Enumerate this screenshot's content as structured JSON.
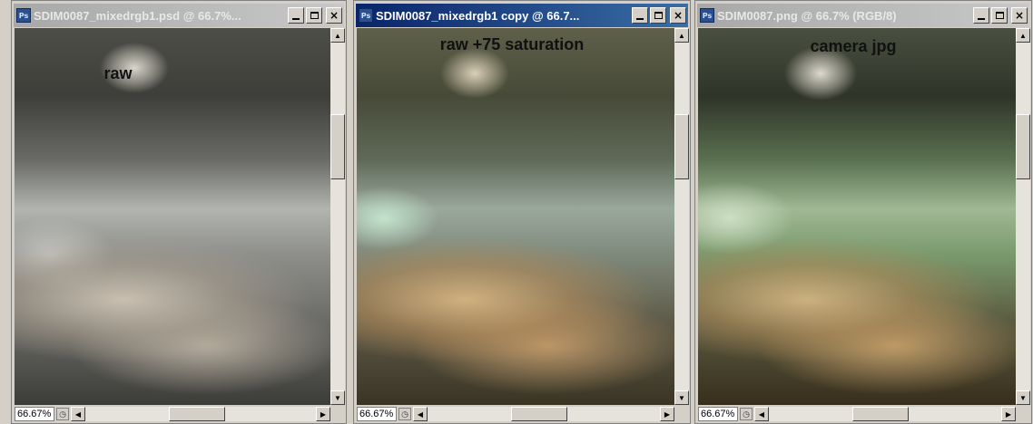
{
  "app_icon": "photoshop-document-icon",
  "icon_label": "Ps",
  "windows": [
    {
      "title": "SDIM0087_mixedrgb1.psd @ 66.7%...",
      "label": "raw",
      "zoom": "66.67%",
      "state": "inactive"
    },
    {
      "title": "SDIM0087_mixedrgb1 copy @ 66.7...",
      "label": "raw +75 saturation",
      "zoom": "66.67%",
      "state": "active"
    },
    {
      "title": "SDIM0087.png @ 66.7% (RGB/8)",
      "label": "camera jpg",
      "zoom": "66.67%",
      "state": "inactive"
    }
  ],
  "buttons": {
    "minimize": "minimize",
    "maximize": "maximize",
    "close": "×"
  },
  "colors": {
    "window_bg": "#d4d0c8",
    "active_title": "#0a246a",
    "inactive_title": "#a8a8a8"
  }
}
